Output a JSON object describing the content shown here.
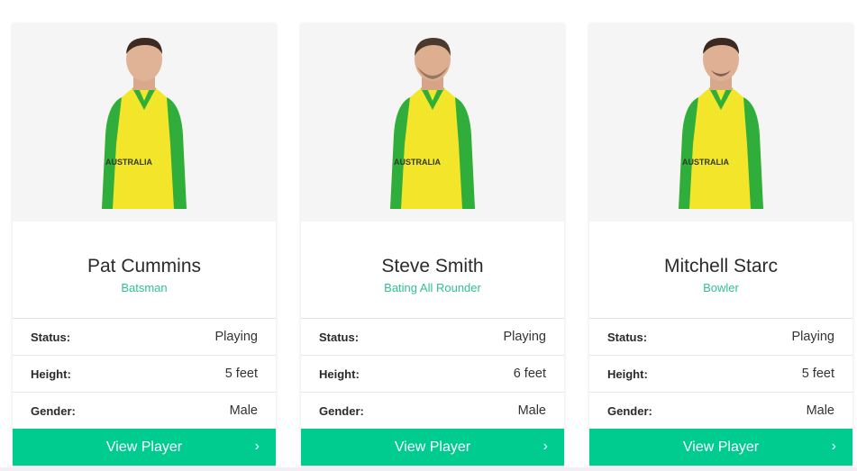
{
  "players": [
    {
      "name": "Pat Cummins",
      "role": "Batsman",
      "fields": [
        {
          "label": "Status:",
          "value": "Playing"
        },
        {
          "label": "Height:",
          "value": "5 feet"
        },
        {
          "label": "Gender:",
          "value": "Male"
        }
      ],
      "button_label": "View Player",
      "jersey_text": "AUSTRALIA"
    },
    {
      "name": "Steve Smith",
      "role": "Bating All Rounder",
      "fields": [
        {
          "label": "Status:",
          "value": "Playing"
        },
        {
          "label": "Height:",
          "value": "6 feet"
        },
        {
          "label": "Gender:",
          "value": "Male"
        }
      ],
      "button_label": "View Player",
      "jersey_text": "AUSTRALIA"
    },
    {
      "name": "Mitchell Starc",
      "role": "Bowler",
      "fields": [
        {
          "label": "Status:",
          "value": "Playing"
        },
        {
          "label": "Height:",
          "value": "5 feet"
        },
        {
          "label": "Gender:",
          "value": "Male"
        }
      ],
      "button_label": "View Player",
      "jersey_text": "AUSTRALIA"
    }
  ],
  "icons": {
    "button_arrow": "chevron-right-icon"
  },
  "colors": {
    "accent": "#00cc8f",
    "role_text": "#2fc38a",
    "jersey_yellow": "#f3e62a",
    "jersey_green": "#2fae3c"
  }
}
